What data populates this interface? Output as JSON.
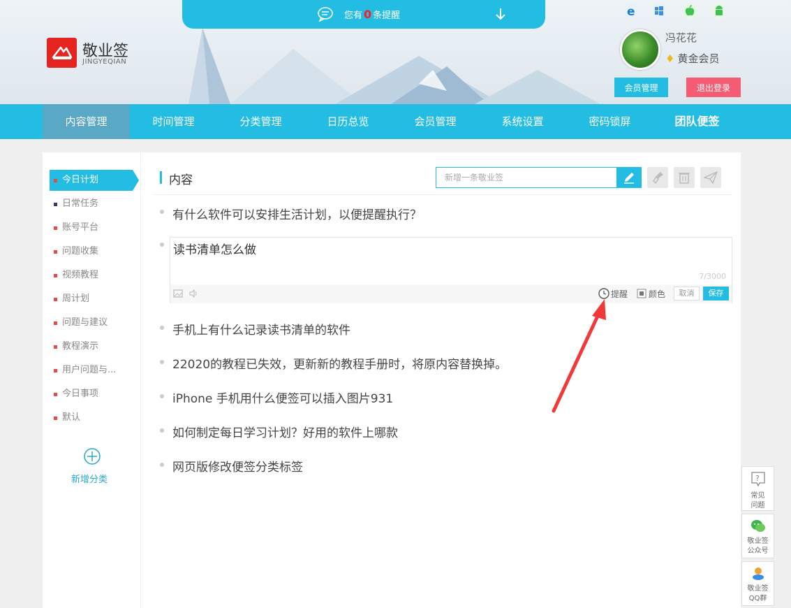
{
  "notice": {
    "prefix": "您有",
    "count": "0",
    "suffix": "条提醒"
  },
  "brand": {
    "name": "敬业签",
    "sub": "JINGYEQIAN"
  },
  "user": {
    "name": "冯花花",
    "level": "黄金会员",
    "member_btn": "会员管理",
    "logout_btn": "退出登录"
  },
  "platforms": [
    "ie-icon",
    "windows-icon",
    "apple-icon",
    "android-icon"
  ],
  "nav": [
    {
      "label": "内容管理",
      "active": true
    },
    {
      "label": "时间管理"
    },
    {
      "label": "分类管理"
    },
    {
      "label": "日历总览"
    },
    {
      "label": "会员管理"
    },
    {
      "label": "系统设置"
    },
    {
      "label": "密码锁屏"
    },
    {
      "label": "团队便签",
      "bold": true
    }
  ],
  "sidebar": {
    "items": [
      {
        "label": "今日计划",
        "active": true
      },
      {
        "label": "日常任务",
        "color": "#3a3a6a"
      },
      {
        "label": "账号平台"
      },
      {
        "label": "问题收集"
      },
      {
        "label": "视频教程"
      },
      {
        "label": "周计划"
      },
      {
        "label": "问题与建议"
      },
      {
        "label": "教程演示"
      },
      {
        "label": "用户问题与..."
      },
      {
        "label": "今日事项"
      },
      {
        "label": "默认"
      }
    ],
    "add_label": "新增分类"
  },
  "content": {
    "title": "内容",
    "new_placeholder": "新增一条敬业签",
    "notes": [
      "有什么软件可以安排生活计划，以便提醒执行？",
      "手机上有什么记录读书清单的软件",
      "22020的教程已失效，更新新的教程手册时，将原内容替换掉。",
      "iPhone 手机用什么便签可以插入图片931",
      "如何制定每日学习计划？好用的软件上哪款",
      "网页版修改便签分类标签"
    ],
    "editor": {
      "text": "读书清单怎么做",
      "count": "7/3000",
      "remind": "提醒",
      "color": "颜色",
      "cancel": "取消",
      "save": "保存"
    }
  },
  "float": {
    "faq": "常见问题",
    "wechat": "敬业签公众号",
    "qq": "敬业签QQ群"
  },
  "colors": {
    "accent": "#23bde4",
    "logout": "#f55b73",
    "arrow": "#f03a3a"
  }
}
